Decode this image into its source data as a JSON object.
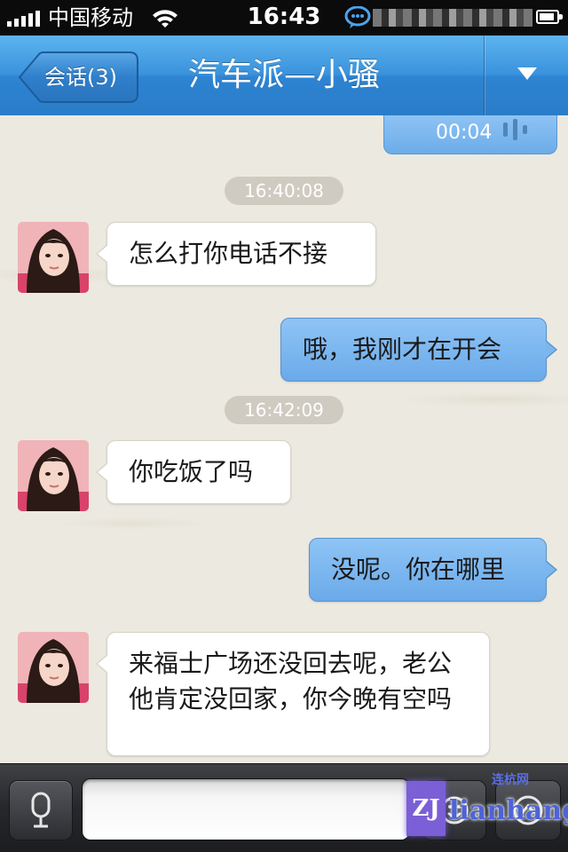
{
  "status_bar": {
    "carrier": "中国移动",
    "time": "16:43"
  },
  "nav": {
    "back_label": "会话(3)",
    "title": "汽车派—小骚"
  },
  "messages": {
    "voice_note": {
      "duration": "00:04"
    },
    "items": [
      {
        "type": "timestamp",
        "text": "16:40:08"
      },
      {
        "type": "incoming",
        "text": "怎么打你电话不接"
      },
      {
        "type": "outgoing",
        "text": "哦，我刚才在开会"
      },
      {
        "type": "timestamp",
        "text": "16:42:09"
      },
      {
        "type": "incoming",
        "text": "你吃饭了吗"
      },
      {
        "type": "outgoing",
        "text": "没呢。你在哪里"
      },
      {
        "type": "incoming",
        "text": "来福士广场还没回去呢，老公他肯定没回家，你今晚有空吗"
      }
    ]
  },
  "input_bar": {
    "text_value": "",
    "placeholder": ""
  },
  "watermark": {
    "logo": "ZJ",
    "small_text": "连杭网",
    "brand": "lianhang"
  },
  "icons": {
    "voice_toggle": "microphone-icon",
    "emoji": "emoji-icon",
    "more": "more-icon",
    "nav_dropdown": "chevron-down-icon",
    "voice_wave": "voice-wave-icon",
    "status_chat": "chat-bubble-icon"
  },
  "colors": {
    "nav_blue": "#3a93dc",
    "outgoing_bubble": "#7bb7ef",
    "incoming_bubble": "#ffffff",
    "background": "#ece9e1",
    "timestamp_pill": "#cfcbc0"
  }
}
